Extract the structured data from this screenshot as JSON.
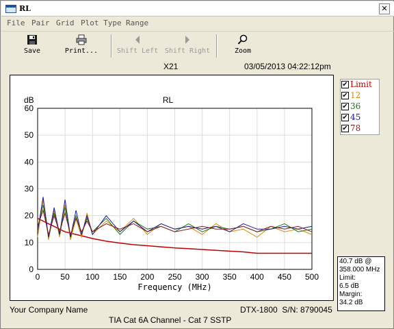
{
  "window": {
    "title": "RL",
    "close_glyph": "✕"
  },
  "menu": [
    "File",
    "Pair",
    "Grid",
    "Plot Type",
    "Range"
  ],
  "toolbar": {
    "save": {
      "label": "Save",
      "icon": "floppy-disk-icon"
    },
    "print": {
      "label": "Print...",
      "icon": "printer-icon"
    },
    "shift_left": {
      "label": "Shift Left",
      "icon": "triangle-left-icon"
    },
    "shift_right": {
      "label": "Shift Right",
      "icon": "triangle-right-icon"
    },
    "zoom": {
      "label": "Zoom",
      "icon": "magnifier-icon"
    }
  },
  "header": {
    "test_id": "X21",
    "datetime": "03/05/2013 04:22:12pm"
  },
  "legend": [
    {
      "label": "Limit",
      "color": "#c00000",
      "checked": true
    },
    {
      "label": "12",
      "color": "#e08a00",
      "checked": true
    },
    {
      "label": "36",
      "color": "#1a7a1a",
      "checked": true
    },
    {
      "label": "45",
      "color": "#1a1a9a",
      "checked": true
    },
    {
      "label": "78",
      "color": "#8b1a1a",
      "checked": true
    }
  ],
  "info": {
    "lines": [
      "40.7 dB @",
      "358.000 MHz",
      "Limit:",
      "6.5 dB",
      "Margin:",
      "34.2 dB"
    ]
  },
  "footer": {
    "company": "Your Company Name",
    "device": "DTX-1800  S/N: 8790045",
    "standard": "TIA Cat 6A Channel - Cat 7 SSTP"
  },
  "chart_data": {
    "type": "line",
    "title": "RL",
    "xlabel": "Frequency (MHz)",
    "ylabel": "dB",
    "xlim": [
      0,
      500
    ],
    "ylim": [
      0,
      60
    ],
    "xticks": [
      0,
      50,
      100,
      150,
      200,
      250,
      300,
      350,
      400,
      450,
      500
    ],
    "yticks": [
      0,
      10,
      20,
      30,
      40,
      50,
      60
    ],
    "grid": true,
    "x": [
      0,
      10,
      20,
      30,
      40,
      50,
      60,
      70,
      80,
      90,
      100,
      125,
      150,
      175,
      200,
      225,
      250,
      275,
      300,
      325,
      350,
      375,
      400,
      425,
      450,
      475,
      500
    ],
    "series": [
      {
        "name": "Limit",
        "color": "#c00000",
        "values": [
          19,
          18,
          17,
          16,
          15,
          14,
          13.5,
          13,
          12.5,
          12,
          11.5,
          10.5,
          9.8,
          9.2,
          8.8,
          8.4,
          8.0,
          7.7,
          7.4,
          7.1,
          6.8,
          6.5,
          6.0,
          6.0,
          6.0,
          6.0,
          6.0
        ]
      },
      {
        "name": "12",
        "color": "#e08a00",
        "values": [
          12,
          26,
          11,
          22,
          12,
          24,
          11,
          19,
          12,
          21,
          13,
          18,
          14,
          19,
          13,
          17,
          15,
          16,
          13,
          17,
          14,
          15,
          12,
          16,
          14,
          15,
          13
        ]
      },
      {
        "name": "36",
        "color": "#1a7a1a",
        "values": [
          15,
          24,
          12,
          21,
          13,
          23,
          12,
          20,
          13,
          19,
          14,
          19,
          13,
          18,
          15,
          16,
          14,
          17,
          14,
          16,
          15,
          16,
          14,
          15,
          17,
          14,
          15
        ]
      },
      {
        "name": "45",
        "color": "#1a1a9a",
        "values": [
          14,
          27,
          12,
          23,
          13,
          26,
          12,
          22,
          13,
          20,
          13,
          20,
          14,
          18,
          14,
          17,
          15,
          16,
          15,
          16,
          14,
          17,
          15,
          15,
          16,
          15,
          16
        ]
      },
      {
        "name": "78",
        "color": "#8b1a1a",
        "values": [
          16,
          22,
          13,
          20,
          14,
          21,
          13,
          19,
          14,
          18,
          14,
          17,
          15,
          17,
          14,
          16,
          14,
          15,
          16,
          15,
          15,
          16,
          14,
          16,
          15,
          16,
          14
        ]
      }
    ]
  }
}
